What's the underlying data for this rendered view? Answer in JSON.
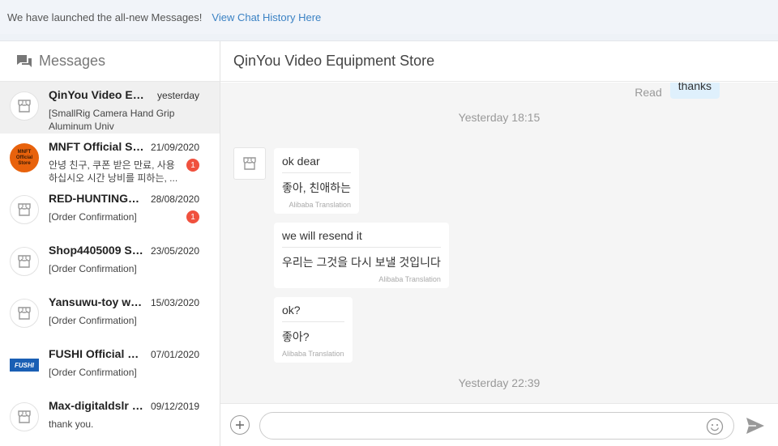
{
  "banner": {
    "message": "We have launched the all-new Messages!",
    "link": "View Chat History Here"
  },
  "sidebar": {
    "title": "Messages",
    "conversations": [
      {
        "name": "QinYou Video Equi...",
        "date": "yesterday",
        "preview": "[SmallRig Camera Hand Grip Aluminum Univ",
        "unread": "",
        "avatar": "shop-icon"
      },
      {
        "name": "MNFT Official St...",
        "date": "21/09/2020",
        "preview": "안녕 친구, 쿠폰 받은 만료, 사용하십시오 시간 낭비를 피하는, ...",
        "unread": "1",
        "avatar": "mnft-logo",
        "logo_text": "MNFT Official Store"
      },
      {
        "name": "RED-HUNTING4 ...",
        "date": "28/08/2020",
        "preview": "[Order Confirmation]",
        "unread": "1",
        "avatar": "shop-icon"
      },
      {
        "name": "Shop4405009 St...",
        "date": "23/05/2020",
        "preview": "[Order Confirmation]",
        "unread": "",
        "avatar": "shop-icon"
      },
      {
        "name": "Yansuwu-toy wo...",
        "date": "15/03/2020",
        "preview": "[Order Confirmation]",
        "unread": "",
        "avatar": "shop-icon"
      },
      {
        "name": "FUSHI Official St...",
        "date": "07/01/2020",
        "preview": "[Order Confirmation]",
        "unread": "",
        "avatar": "fushi-logo",
        "logo_text": "FUSHI"
      },
      {
        "name": "Max-digitaldslr S...",
        "date": "09/12/2019",
        "preview": "thank you.",
        "unread": "",
        "avatar": "shop-icon"
      }
    ]
  },
  "chat": {
    "title": "QinYou Video Equipment Store",
    "read_label": "Read",
    "own_message": "thanks",
    "timestamps": [
      "Yesterday 18:15",
      "Yesterday 22:39"
    ],
    "messages": [
      {
        "original": "ok dear",
        "translation": "좋아, 친애하는",
        "attribution": "Alibaba Translation"
      },
      {
        "original": "we will resend it",
        "translation": "우리는 그것을 다시 보낼 것입니다",
        "attribution": "Alibaba Translation"
      },
      {
        "original": "ok?",
        "translation": "좋아?",
        "attribution": "Alibaba Translation"
      }
    ],
    "composer": {
      "placeholder": ""
    }
  },
  "colors": {
    "accent_link": "#3b82c4",
    "unread_badge": "#f0513e",
    "own_bubble": "#dff0fc",
    "mnft_brand": "#e8620c",
    "fushi_brand": "#1a5fb4"
  }
}
